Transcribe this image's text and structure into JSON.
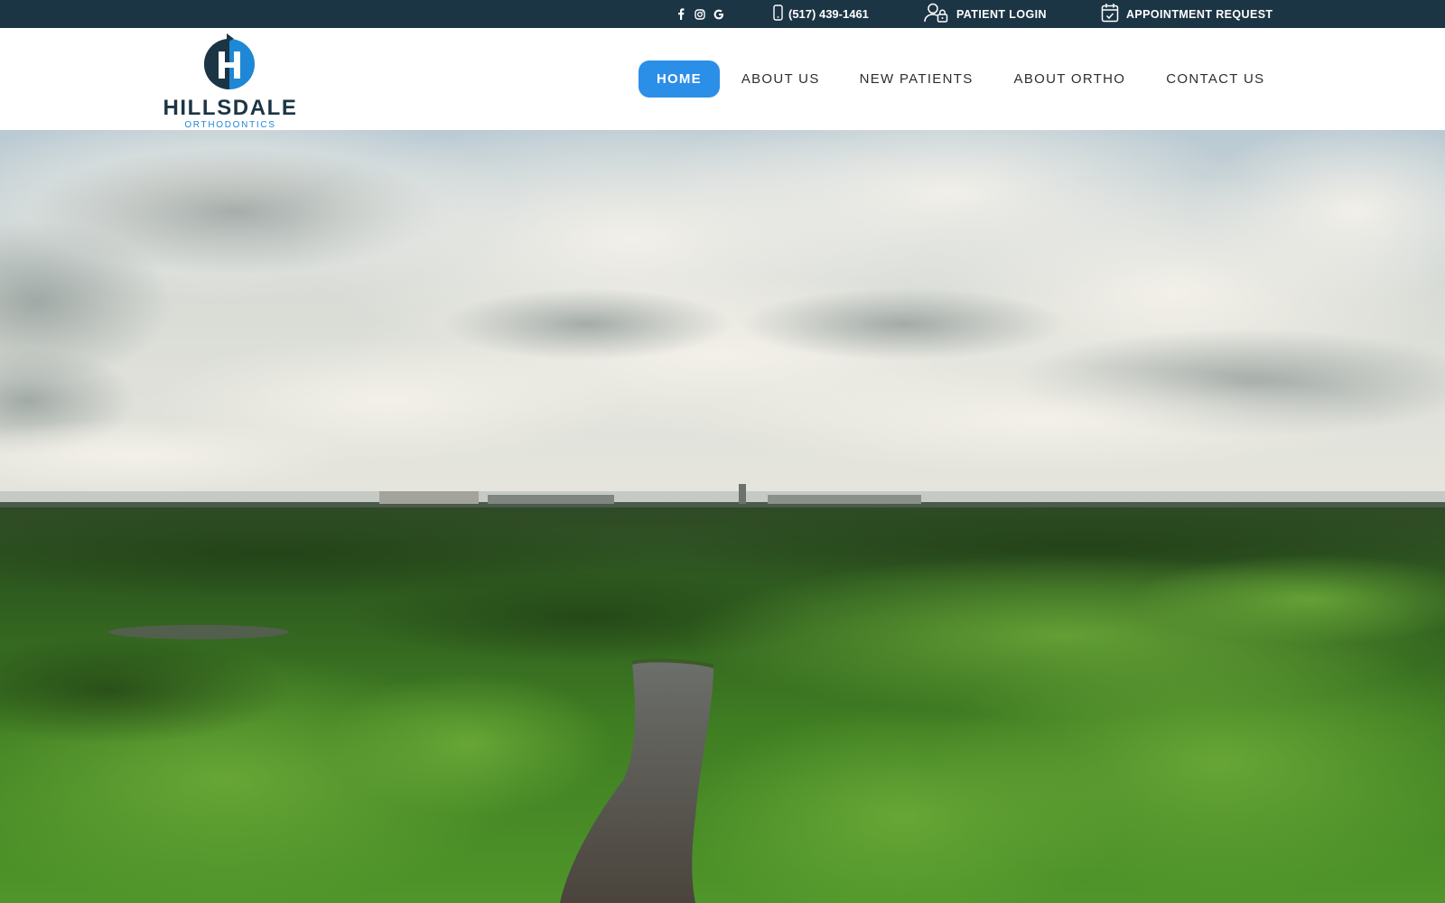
{
  "topbar": {
    "social_icons": [
      "facebook-icon",
      "instagram-icon",
      "google-icon"
    ],
    "phone": "(517) 439-1461",
    "patient_login": "PATIENT LOGIN",
    "appointment_request": "APPOINTMENT REQUEST",
    "background_color": "#1c3545"
  },
  "logo": {
    "name": "HILLSDALE",
    "tagline": "ORTHODONTICS",
    "colors": {
      "navy": "#1c3545",
      "blue": "#1e87d6"
    }
  },
  "nav": {
    "items": [
      {
        "label": "HOME",
        "active": true
      },
      {
        "label": "ABOUT US",
        "active": false
      },
      {
        "label": "NEW PATIENTS",
        "active": false
      },
      {
        "label": "ABOUT ORTHO",
        "active": false
      },
      {
        "label": "CONTACT US",
        "active": false
      }
    ],
    "active_color": "#2b8fe8"
  },
  "hero": {
    "content": "aerial-landscape-video",
    "colors": {
      "sky": "#cfd9dc",
      "forest": "#3f7a22",
      "river": "#4d4a44"
    }
  }
}
